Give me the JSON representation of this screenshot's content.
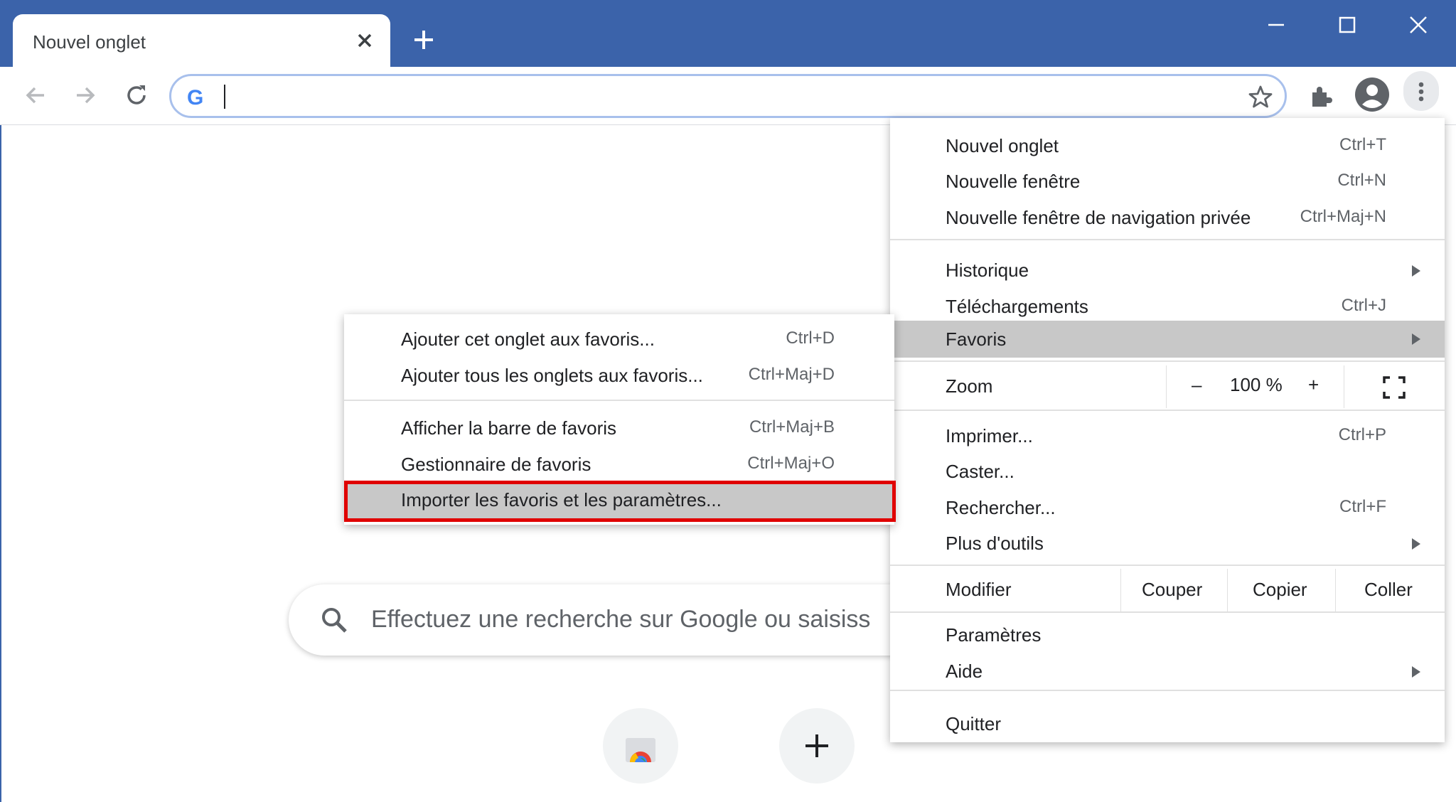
{
  "window": {
    "tab_title": "Nouvel onglet",
    "accent": "#3b63aa",
    "controls": [
      "minimize-icon",
      "maximize-icon",
      "close-icon"
    ]
  },
  "toolbar": {
    "omnibox_value": "",
    "icons": [
      "back-icon",
      "forward-icon",
      "reload-icon",
      "star-icon",
      "extensions-icon",
      "profile-icon",
      "more-menu-icon"
    ]
  },
  "ntp": {
    "search_placeholder": "Effectuez une recherche sur Google ou saisiss"
  },
  "main_menu": {
    "items": [
      {
        "label": "Nouvel onglet",
        "shortcut": "Ctrl+T"
      },
      {
        "label": "Nouvelle fenêtre",
        "shortcut": "Ctrl+N"
      },
      {
        "label": "Nouvelle fenêtre de navigation privée",
        "shortcut": "Ctrl+Maj+N"
      },
      {
        "label": "Historique",
        "shortcut": ""
      },
      {
        "label": "Téléchargements",
        "shortcut": "Ctrl+J"
      },
      {
        "label": "Favoris",
        "shortcut": ""
      },
      {
        "label": "Imprimer...",
        "shortcut": "Ctrl+P"
      },
      {
        "label": "Caster...",
        "shortcut": ""
      },
      {
        "label": "Rechercher...",
        "shortcut": "Ctrl+F"
      },
      {
        "label": "Plus d'outils",
        "shortcut": ""
      },
      {
        "label": "Paramètres",
        "shortcut": ""
      },
      {
        "label": "Aide",
        "shortcut": ""
      },
      {
        "label": "Quitter",
        "shortcut": ""
      }
    ],
    "zoom": {
      "label": "Zoom",
      "minus": "–",
      "value": "100 %",
      "plus": "+"
    },
    "edit": {
      "label": "Modifier",
      "cut": "Couper",
      "copy": "Copier",
      "paste": "Coller"
    }
  },
  "sub_menu": {
    "items": [
      {
        "label": "Ajouter cet onglet aux favoris...",
        "shortcut": "Ctrl+D"
      },
      {
        "label": "Ajouter tous les onglets aux favoris...",
        "shortcut": "Ctrl+Maj+D"
      },
      {
        "label": "Afficher la barre de favoris",
        "shortcut": "Ctrl+Maj+B"
      },
      {
        "label": "Gestionnaire de favoris",
        "shortcut": "Ctrl+Maj+O"
      },
      {
        "label": "Importer les favoris et les paramètres...",
        "shortcut": ""
      }
    ],
    "highlight_color": "#e00000"
  }
}
